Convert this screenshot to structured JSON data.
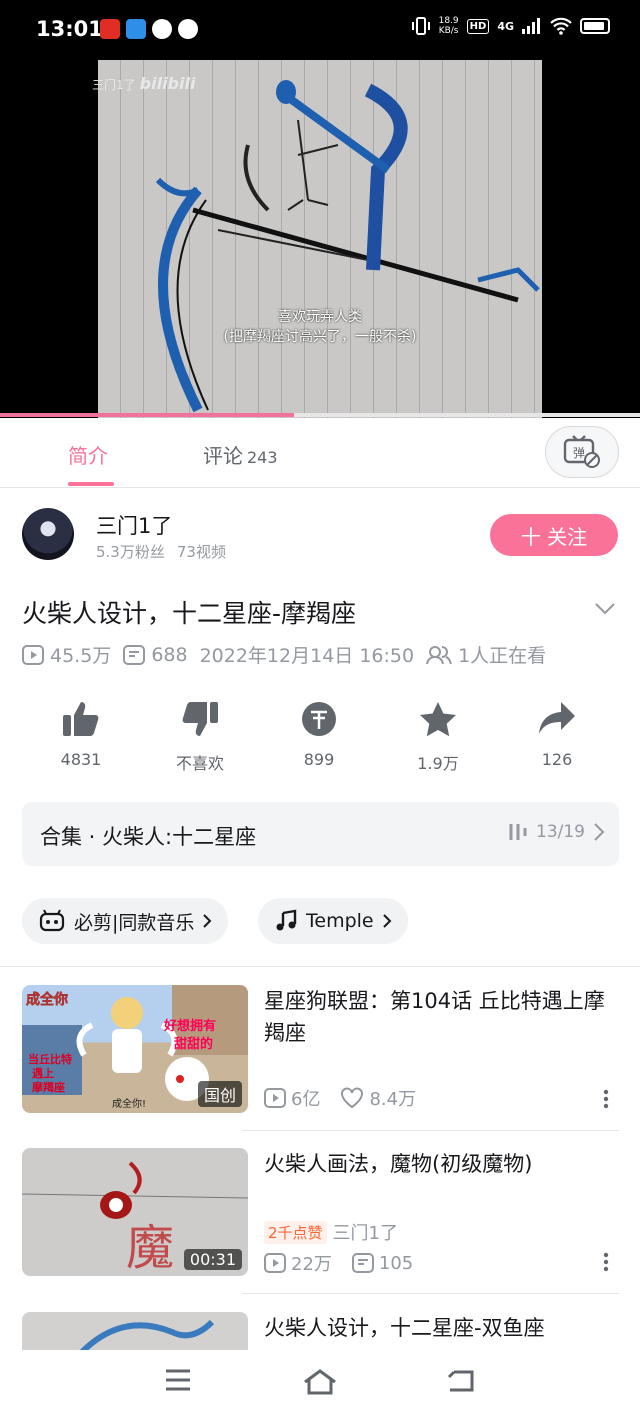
{
  "status_bar": {
    "time": "13:01",
    "speed_value": "18.9",
    "speed_unit": "KB/s",
    "hd": "HD",
    "network": "4G"
  },
  "video": {
    "watermark_user": "三门1了",
    "watermark_brand": "bilibili",
    "subtitle_line1": "喜欢玩弄人类",
    "subtitle_line2": "(把摩羯座讨高兴了，一般不杀)",
    "progress": 0.46
  },
  "tabs": {
    "intro": "简介",
    "comments": "评论",
    "comments_count": "243"
  },
  "uploader": {
    "name": "三门1了",
    "fans": "5.3万粉丝",
    "videos": "73视频",
    "follow_label": "十 关注"
  },
  "video_info": {
    "title": "火柴人设计，十二星座-摩羯座",
    "views": "45.5万",
    "danmaku": "688",
    "date": "2022年12月14日 16:50",
    "watching": "1人正在看"
  },
  "actions": {
    "like": "4831",
    "dislike": "不喜欢",
    "coin": "899",
    "favorite": "1.9万",
    "share": "126"
  },
  "collection": {
    "label": "合集 · 火柴人:十二星座",
    "progress": "13/19"
  },
  "tags": {
    "music": "必剪|同款音乐",
    "song": "Temple"
  },
  "recommend": [
    {
      "title": "星座狗联盟：第104话 丘比特遇上摩羯座",
      "badge": "国创",
      "views": "6亿",
      "likes": "8.4万",
      "thumb_texts": [
        "成全你",
        "好想拥有",
        "甜甜的",
        "当丘比特",
        "遇上",
        "摩羯座",
        "成全你!"
      ]
    },
    {
      "title": "火柴人画法，魔物(初级魔物)",
      "badge": "00:31",
      "hot": "2千点赞",
      "author": "三门1了",
      "views": "22万",
      "danmaku": "105",
      "thumb_text": "魔"
    },
    {
      "title": "火柴人设计，十二星座-双鱼座"
    }
  ],
  "colors": {
    "accent": "#fb7299",
    "text": "#18191c",
    "muted": "#9499a0",
    "hot": "#ff6633"
  },
  "icons": [
    "menu-icon",
    "home-icon",
    "back-icon",
    "danmaku-off-icon",
    "like-icon",
    "dislike-icon",
    "coin-icon",
    "star-icon",
    "share-icon",
    "play-icon",
    "danmaku-icon",
    "watching-icon",
    "chevron-down-icon",
    "chevron-right-icon",
    "music-note-icon",
    "more-icon",
    "heart-icon"
  ]
}
